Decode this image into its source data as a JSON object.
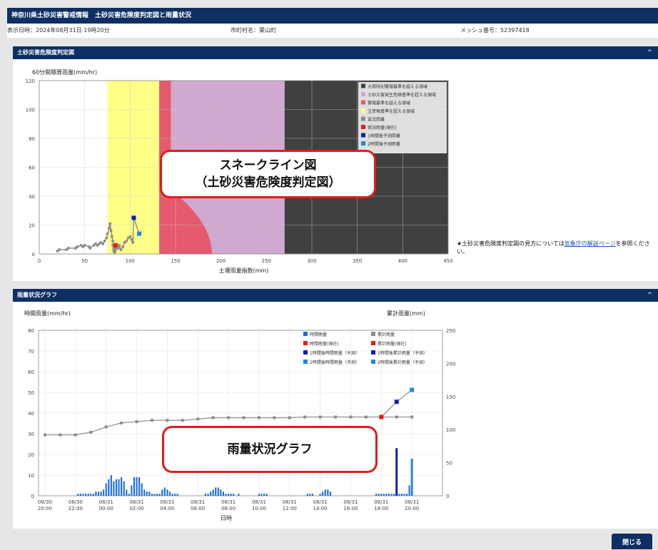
{
  "header": {
    "title": "神奈川県土砂災害警戒情報　土砂災害危険度判定図と雨量状況",
    "display_time": "表示日時：2024年08月31日 19時20分",
    "municipality": "市町村名：葉山町",
    "mesh": "メッシュ番号：52397418"
  },
  "snake_section": {
    "title": "土砂災害危険度判定図",
    "chevron": "^",
    "note_text": "★土砂災害危険度判定図の見方については",
    "note_link": "気象庁の解説ページ",
    "note_tail": "を参照ください。"
  },
  "rain_section": {
    "title": "雨量状況グラフ",
    "chevron": "^"
  },
  "callouts": {
    "snake_line1": "スネークライン図",
    "snake_line2": "（土砂災害危険度判定図）",
    "rain": "雨量状況グラフ"
  },
  "footer": {
    "close_label": "閉じる"
  },
  "colors": {
    "navy": "#0d2f63",
    "yellow": "#ffff88",
    "red_zone": "#e55a6e",
    "purple_zone": "#cfa9cf",
    "black_zone": "#404040",
    "hourly_bar": "#1e6fdc",
    "cumulative": "#8c8c8c",
    "current": "#e31a1a",
    "forecast1": "#0b1fb8",
    "forecast2": "#1e88e5"
  },
  "chart_data": [
    {
      "type": "scatter",
      "ylabel": "60分間積算雨量(mm/hr)",
      "xlabel": "土壌雨量指数(mm)",
      "xlim": [
        0,
        450
      ],
      "ylim": [
        0,
        120
      ],
      "xticks": [
        "0",
        "50",
        "100",
        "150",
        "200",
        "250",
        "300",
        "350",
        "400",
        "450"
      ],
      "yticks": [
        "0",
        "20",
        "40",
        "60",
        "80",
        "100",
        "120"
      ],
      "zones": [
        {
          "name": "注意報基準を超える領域",
          "x_from": 75,
          "x_to": 132,
          "color": "#ffff88"
        },
        {
          "name": "警報基準を超える領域",
          "x_from": 132,
          "x_to": 145,
          "color": "#e55a6e"
        },
        {
          "name": "土砂災害発生危険基準を超える領域",
          "x_from": 145,
          "x_to": 270,
          "color": "#cfa9cf"
        },
        {
          "name": "大雨特別警報基準を超える領域",
          "x_from": 270,
          "x_to": 450,
          "color": "#404040"
        }
      ],
      "legend": [
        "大雨特別警報基準を超える領域",
        "土砂災害発生危険基準を超える領域",
        "警報基準を超える領域",
        "注意報基準を超える領域",
        "実況雨量",
        "実況雨量(現在)",
        "1時間後予測雨量",
        "2時間後予測雨量"
      ],
      "legend_position": "top-right",
      "series": [
        {
          "name": "実況雨量",
          "points": [
            [
              20,
              2
            ],
            [
              22,
              3
            ],
            [
              30,
              3
            ],
            [
              32,
              4
            ],
            [
              40,
              4
            ],
            [
              42,
              5
            ],
            [
              46,
              6
            ],
            [
              48,
              5
            ],
            [
              50,
              6
            ],
            [
              55,
              5
            ],
            [
              56,
              4
            ],
            [
              60,
              6
            ],
            [
              62,
              7
            ],
            [
              64,
              6
            ],
            [
              66,
              7
            ],
            [
              68,
              8
            ],
            [
              70,
              7
            ],
            [
              72,
              9
            ],
            [
              74,
              11
            ],
            [
              75,
              14
            ],
            [
              77,
              18
            ],
            [
              78,
              21
            ],
            [
              79,
              16
            ],
            [
              80,
              12
            ],
            [
              81,
              9
            ],
            [
              81,
              6
            ],
            [
              82,
              4
            ],
            [
              82,
              2
            ],
            [
              83,
              1
            ],
            [
              84,
              3
            ],
            [
              85,
              5
            ],
            [
              87,
              4
            ],
            [
              88,
              6
            ],
            [
              90,
              3
            ],
            [
              92,
              5
            ],
            [
              94,
              8
            ],
            [
              96,
              9
            ],
            [
              98,
              11
            ],
            [
              100,
              12
            ],
            [
              102,
              10
            ],
            [
              103,
              8
            ]
          ]
        },
        {
          "name": "実況雨量(現在)",
          "points": [
            [
              84,
              6
            ]
          ]
        },
        {
          "name": "1時間後予測雨量",
          "points": [
            [
              104,
              25
            ]
          ]
        },
        {
          "name": "2時間後予測雨量",
          "points": [
            [
              110,
              14
            ]
          ]
        }
      ]
    },
    {
      "type": "bar",
      "ylabel": "時間雨量(mm/hr)",
      "y2label": "累計雨量(mm)",
      "xlabel": "日時",
      "ylim": [
        0,
        80
      ],
      "y2lim": [
        0,
        250
      ],
      "yticks": [
        "0",
        "10",
        "20",
        "30",
        "40",
        "50",
        "60",
        "70",
        "80"
      ],
      "y2ticks": [
        "0",
        "50",
        "100",
        "150",
        "200",
        "250"
      ],
      "xticks": [
        [
          "08/30",
          "20:00"
        ],
        [
          "08/30",
          "22:00"
        ],
        [
          "08/31",
          "00:00"
        ],
        [
          "08/31",
          "02:00"
        ],
        [
          "08/31",
          "04:00"
        ],
        [
          "08/31",
          "06:00"
        ],
        [
          "08/31",
          "08:00"
        ],
        [
          "08/31",
          "10:00"
        ],
        [
          "08/31",
          "12:00"
        ],
        [
          "08/31",
          "14:00"
        ],
        [
          "08/31",
          "16:00"
        ],
        [
          "08/31",
          "18:00"
        ],
        [
          "08/31",
          "20:00"
        ]
      ],
      "legend": [
        "時間雨量",
        "累計雨量",
        "時間雨量(現在)",
        "累計雨量(現在)",
        "1時間後時間雨量（予測）",
        "1時間後累計雨量（予測）",
        "2時間後時間雨量（予測）",
        "2時間後累計雨量（予測）"
      ],
      "legend_position": "top-right",
      "hourly_10min": [
        0,
        0,
        0,
        0,
        0,
        0,
        0,
        0,
        0,
        0,
        0,
        0,
        0,
        1,
        1,
        1,
        1,
        1,
        1,
        1,
        2,
        2,
        2,
        3,
        6,
        8,
        10,
        7,
        8,
        8,
        9,
        7,
        3,
        1,
        5,
        9,
        9,
        9,
        6,
        3,
        2,
        2,
        1,
        1,
        1,
        1,
        3,
        4,
        3,
        2,
        1,
        1,
        1,
        0,
        0,
        0,
        0,
        0,
        0,
        0,
        0,
        0,
        0,
        1,
        1,
        2,
        3,
        4,
        4,
        3,
        2,
        1,
        1,
        1,
        1,
        0,
        1,
        0,
        0,
        0,
        0,
        0,
        0,
        0,
        1,
        1,
        1,
        1,
        0,
        0,
        0,
        0,
        0,
        0,
        0,
        0,
        0,
        0,
        0,
        0,
        0,
        0,
        0,
        1,
        1,
        1,
        0,
        0,
        1,
        2,
        3,
        3,
        2,
        0,
        0,
        0,
        0,
        0,
        0,
        0,
        0,
        0,
        0,
        0,
        0,
        0,
        0,
        0,
        0,
        0,
        1,
        1,
        1,
        1,
        1,
        1,
        1,
        1,
        1,
        1,
        1,
        1,
        1,
        5
      ],
      "cumulative_hourly": [
        92,
        92,
        92,
        96,
        104,
        110,
        112,
        114,
        114,
        114,
        116,
        118,
        118,
        118,
        118,
        118,
        118,
        119,
        119,
        119,
        119,
        119,
        119,
        119,
        119
      ],
      "current_cumulative": 119,
      "forecast1_hourly": 23,
      "forecast1_cumulative": 142,
      "forecast2_hourly": 18,
      "forecast2_cumulative": 160
    }
  ]
}
